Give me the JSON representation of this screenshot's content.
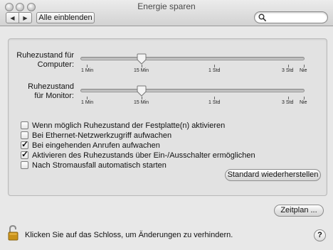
{
  "window": {
    "title": "Energie sparen"
  },
  "toolbar": {
    "back_icon": "triangle-left",
    "forward_icon": "triangle-right",
    "show_all_label": "Alle einblenden",
    "search_placeholder": ""
  },
  "sliders": [
    {
      "label_line1": "Ruhezustand für",
      "label_line2": "Computer:",
      "value": "15 Min",
      "ticks": [
        "1 Min",
        "15 Min",
        "1 Std",
        "3 Std",
        "Nie"
      ]
    },
    {
      "label_line1": "Ruhezustand",
      "label_line2": "für Monitor:",
      "value": "15 Min",
      "ticks": [
        "1 Min",
        "15 Min",
        "1 Std",
        "3 Std",
        "Nie"
      ]
    }
  ],
  "options": [
    {
      "label": "Wenn möglich Ruhezustand der Festplatte(n) aktivieren",
      "checked": false
    },
    {
      "label": "Bei Ethernet-Netzwerkzugriff aufwachen",
      "checked": false
    },
    {
      "label": "Bei eingehenden Anrufen aufwachen",
      "checked": true
    },
    {
      "label": "Aktivieren des Ruhezustands über Ein-/Ausschalter ermöglichen",
      "checked": true
    },
    {
      "label": "Nach Stromausfall automatisch starten",
      "checked": false
    }
  ],
  "buttons": {
    "restore_defaults": "Standard wiederherstellen",
    "schedule": "Zeitplan ..."
  },
  "footer": {
    "lock_text": "Klicken Sie auf das Schloss, um Änderungen zu verhindern.",
    "help_label": "?"
  },
  "colors": {
    "window_bg": "#e8e8e8",
    "group_bg": "#e2e2e2",
    "lock_gold": "#c9921a"
  }
}
